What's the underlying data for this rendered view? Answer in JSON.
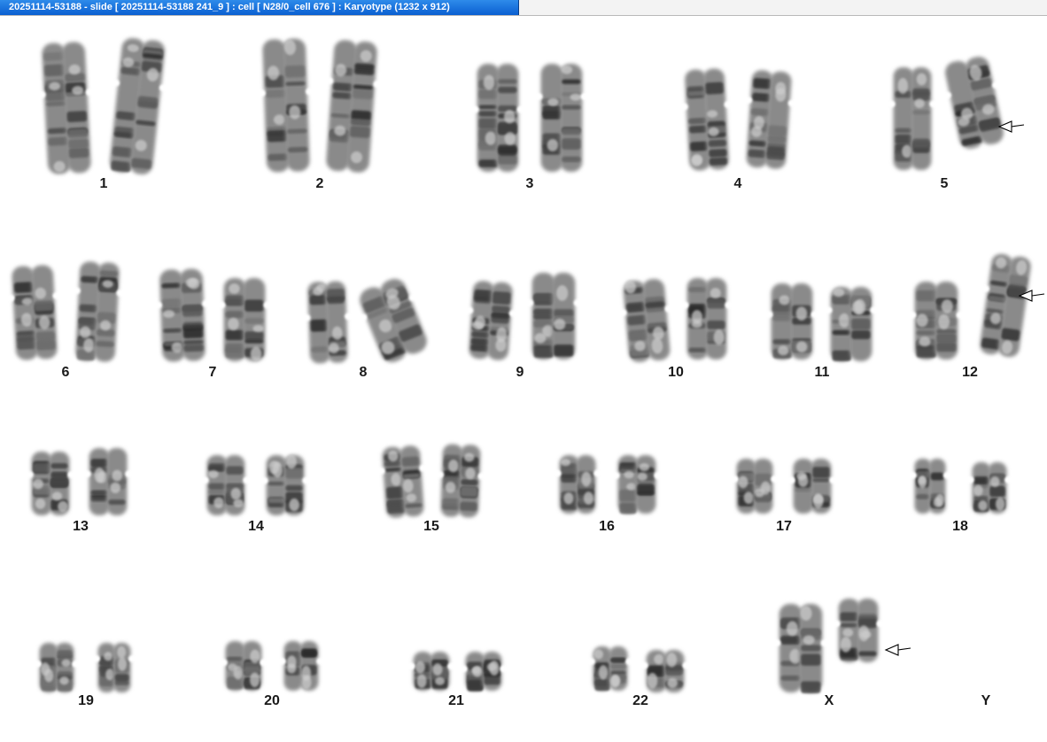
{
  "window": {
    "title": "20251114-53188 - slide [ 20251114-53188 241_9 ] : cell [ N28/0_cell 676 ] : Karyotype  (1232 x 912)"
  },
  "chromosome_labels": [
    "1",
    "2",
    "3",
    "4",
    "5",
    "6",
    "7",
    "8",
    "9",
    "10",
    "11",
    "12",
    "13",
    "14",
    "15",
    "16",
    "17",
    "18",
    "19",
    "20",
    "21",
    "22",
    "X",
    "Y"
  ],
  "annotations": {
    "arrow_markers": [
      "5",
      "12",
      "X"
    ]
  }
}
